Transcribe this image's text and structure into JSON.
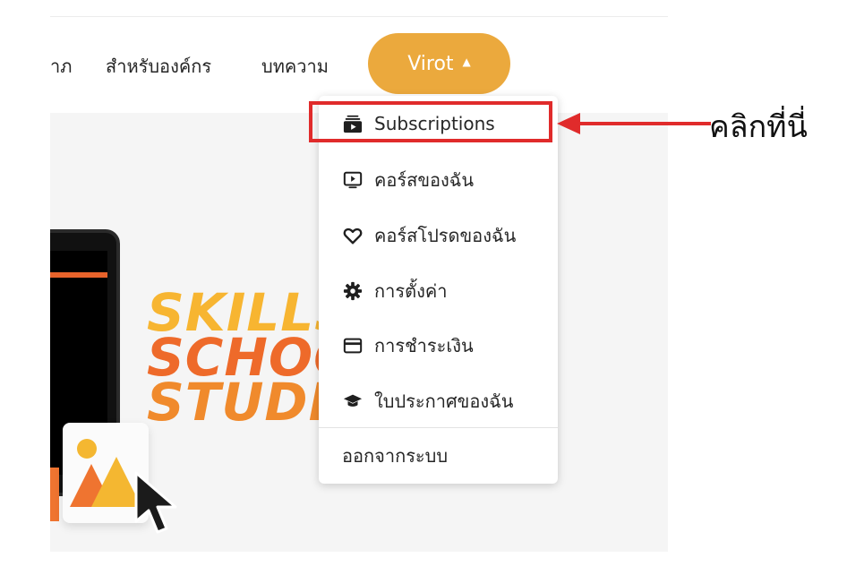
{
  "nav": {
    "links": [
      "าภ",
      "สำหรับองค์กร",
      "บทความ"
    ],
    "user_button": {
      "label": "Virot",
      "caret": "▲"
    }
  },
  "hero": {
    "lines": [
      "SKILLS",
      "SCHOO",
      "STUDI"
    ]
  },
  "dropdown": {
    "items": [
      {
        "label": "Subscriptions",
        "icon": "subscriptions-icon"
      },
      {
        "label": "คอร์สของฉัน",
        "icon": "play-screen-icon"
      },
      {
        "label": "คอร์สโปรดของฉัน",
        "icon": "heart-icon"
      },
      {
        "label": "การตั้งค่า",
        "icon": "gear-icon"
      },
      {
        "label": "การชำระเงิน",
        "icon": "credit-card-icon"
      },
      {
        "label": "ใบประกาศของฉัน",
        "icon": "graduation-cap-icon"
      }
    ],
    "logout": "ออกจากระบบ"
  },
  "annotation": {
    "callout": "คลิกที่นี่",
    "color": "#e02b2b"
  },
  "colors": {
    "accent": "#eba93d"
  }
}
